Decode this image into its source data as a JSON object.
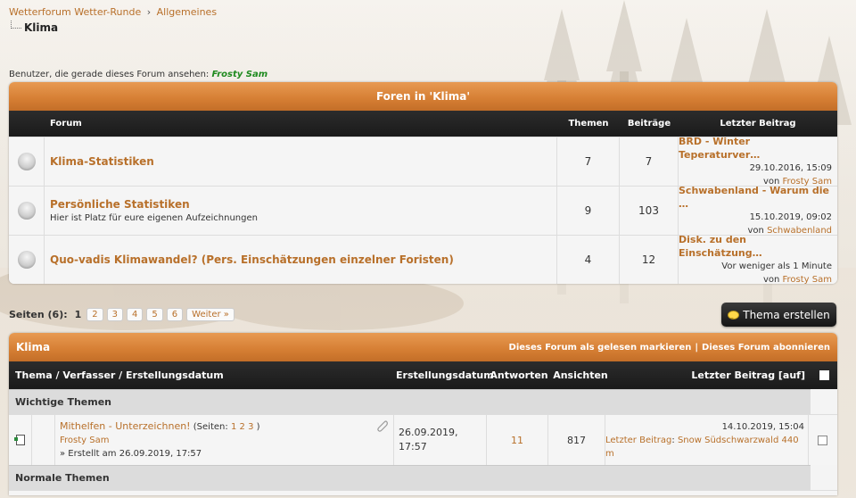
{
  "breadcrumb": {
    "root": "Wetterforum Wetter-Runde",
    "separator": "›",
    "parent": "Allgemeines",
    "current": "Klima"
  },
  "viewers": {
    "label": "Benutzer, die gerade dieses Forum ansehen:",
    "user": "Frosty Sam"
  },
  "forums_box": {
    "title": "Foren in 'Klima'",
    "columns": {
      "forum": "Forum",
      "themen": "Themen",
      "beitraege": "Beiträge",
      "last": "Letzter Beitrag"
    },
    "rows": [
      {
        "title": "Klima-Statistiken",
        "desc": "",
        "themen": "7",
        "beitraege": "7",
        "last_title": "BRD - Winter Teperaturver…",
        "last_date": "29.10.2016, 15:09",
        "last_by_prefix": "von",
        "last_user": "Frosty Sam"
      },
      {
        "title": "Persönliche Statistiken",
        "desc": "Hier ist Platz für eure eigenen Aufzeichnungen",
        "themen": "9",
        "beitraege": "103",
        "last_title": "Schwabenland - Warum die …",
        "last_date": "15.10.2019, 09:02",
        "last_by_prefix": "von",
        "last_user": "Schwabenland"
      },
      {
        "title": "Quo-vadis Klimawandel? (Pers. Einschätzungen einzelner Foristen)",
        "desc": "",
        "themen": "4",
        "beitraege": "12",
        "last_title": "Disk. zu den Einschätzung…",
        "last_date": "Vor weniger als 1 Minute",
        "last_by_prefix": "von",
        "last_user": "Frosty Sam"
      }
    ]
  },
  "pager": {
    "label": "Seiten (6):",
    "current": "1",
    "pages": [
      "2",
      "3",
      "4",
      "5",
      "6"
    ],
    "next": "Weiter »"
  },
  "new_thread_button": "Thema erstellen",
  "threads_box": {
    "title": "Klima",
    "mark_read": "Dieses Forum als gelesen markieren",
    "separator": "|",
    "subscribe": "Dieses Forum abonnieren",
    "columns": {
      "thread": "Thema / Verfasser / Erstellungsdatum",
      "created": "Erstellungsdatum",
      "answers": "Antworten",
      "views": "Ansichten",
      "last": "Letzter Beitrag [auf]"
    },
    "section_important": "Wichtige Themen",
    "section_normal": "Normale Themen",
    "important_threads": [
      {
        "title": "Mithelfen - Unterzeichnen!",
        "pages_prefix": "(Seiten:",
        "pages": [
          "1",
          "2",
          "3"
        ],
        "pages_suffix": ")",
        "author": "Frosty Sam",
        "created_line": "» Erstellt am 26.09.2019, 17:57",
        "created_date": "26.09.2019,",
        "created_time": "17:57",
        "answers": "11",
        "views": "817",
        "last_date": "14.10.2019, 15:04",
        "last_label": "Letzter Beitrag",
        "last_colon": ":",
        "last_user": "Snow Südschwarzwald 440 m"
      }
    ]
  }
}
